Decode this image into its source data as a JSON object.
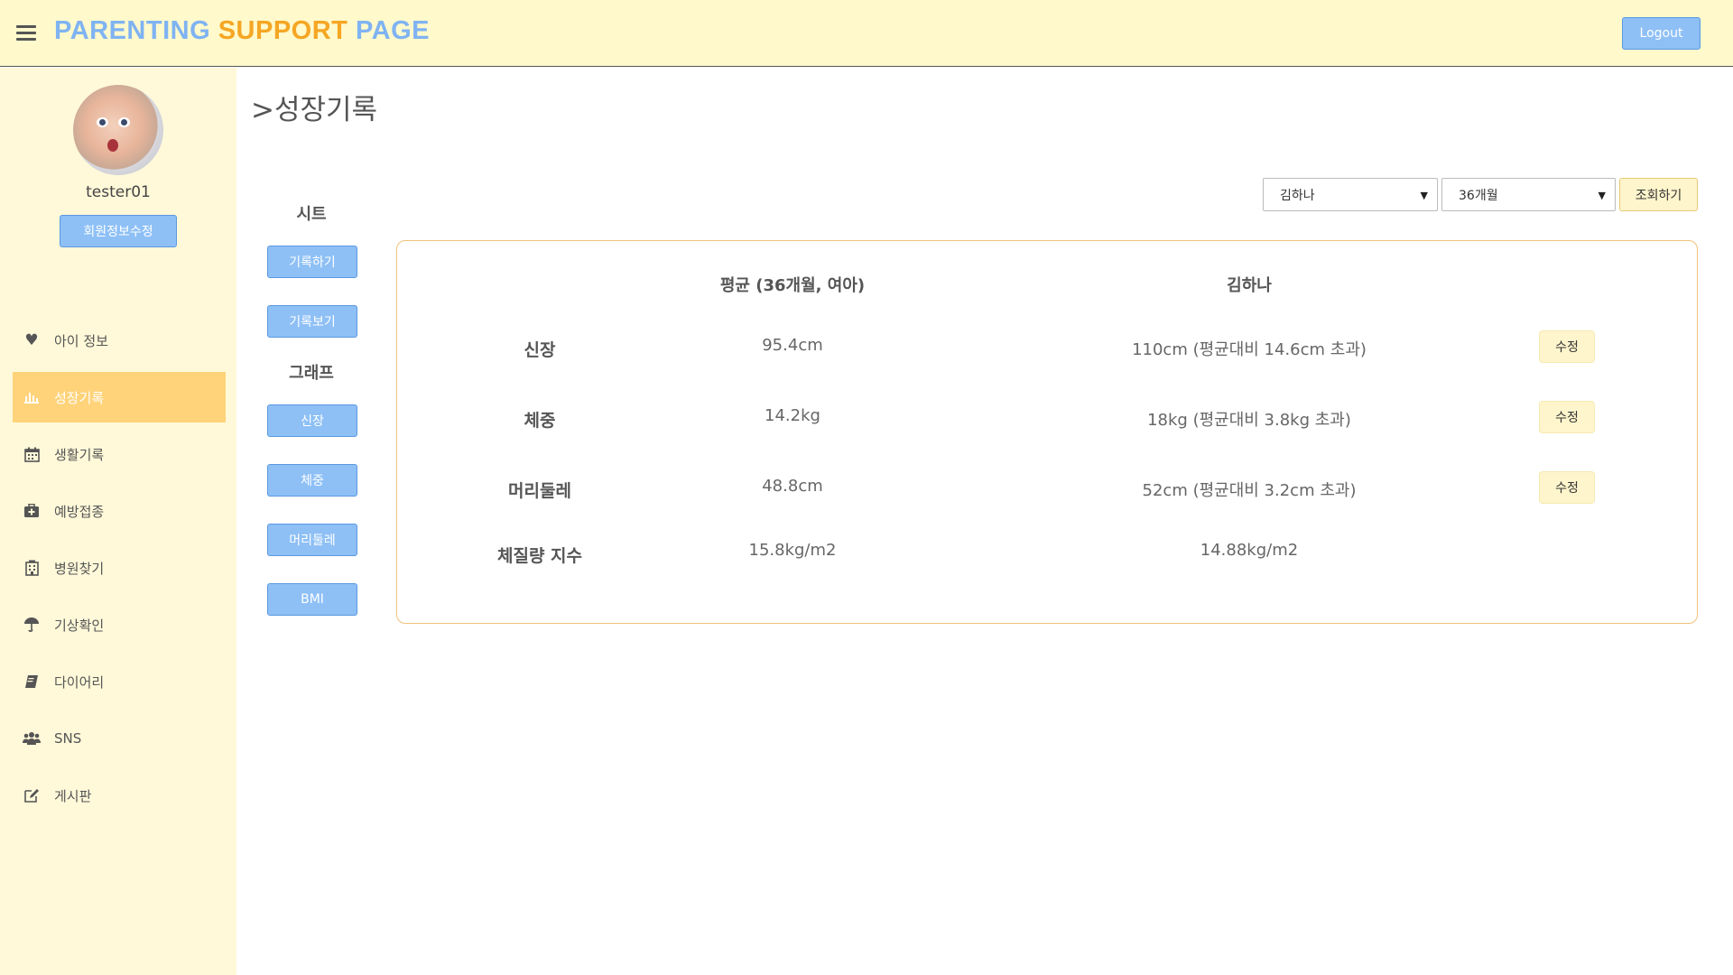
{
  "header": {
    "brand_part1": "PARENTING",
    "brand_part2": "SUPPORT",
    "brand_part3": "PAGE",
    "logout_label": "Logout"
  },
  "sidebar": {
    "username": "tester01",
    "profile_edit_label": "회원정보수정",
    "items": [
      {
        "label": "아이 정보",
        "icon": "heart-icon",
        "active": false
      },
      {
        "label": "성장기록",
        "icon": "bar-chart-icon",
        "active": true
      },
      {
        "label": "생활기록",
        "icon": "calendar-icon",
        "active": false
      },
      {
        "label": "예방접종",
        "icon": "medkit-icon",
        "active": false
      },
      {
        "label": "병원찾기",
        "icon": "hospital-icon",
        "active": false
      },
      {
        "label": "기상확인",
        "icon": "umbrella-icon",
        "active": false
      },
      {
        "label": "다이어리",
        "icon": "book-icon",
        "active": false
      },
      {
        "label": "SNS",
        "icon": "users-icon",
        "active": false
      },
      {
        "label": "게시판",
        "icon": "edit-icon",
        "active": false
      }
    ]
  },
  "main": {
    "title": ">성장기록",
    "filters": {
      "child_selected": "김하나",
      "month_selected": "36개월",
      "search_label": "조회하기"
    },
    "sheet_label": "시트",
    "sheet_buttons": [
      "기록하기",
      "기록보기"
    ],
    "graph_label": "그래프",
    "graph_buttons": [
      "신장",
      "체중",
      "머리둘레",
      "BMI"
    ],
    "table": {
      "col_avg": "평균 (36개월, 여아)",
      "col_child": "김하나",
      "edit_label": "수정",
      "rows": [
        {
          "label": "신장",
          "avg": "95.4cm",
          "child": "110cm (평균대비 14.6cm 초과)",
          "editable": true
        },
        {
          "label": "체중",
          "avg": "14.2kg",
          "child": "18kg (평균대비 3.8kg 초과)",
          "editable": true
        },
        {
          "label": "머리둘레",
          "avg": "48.8cm",
          "child": "52cm (평균대비 3.2cm 초과)",
          "editable": true
        },
        {
          "label": "체질량 지수",
          "avg": "15.8kg/m2",
          "child": "14.88kg/m2",
          "editable": false
        }
      ]
    }
  }
}
